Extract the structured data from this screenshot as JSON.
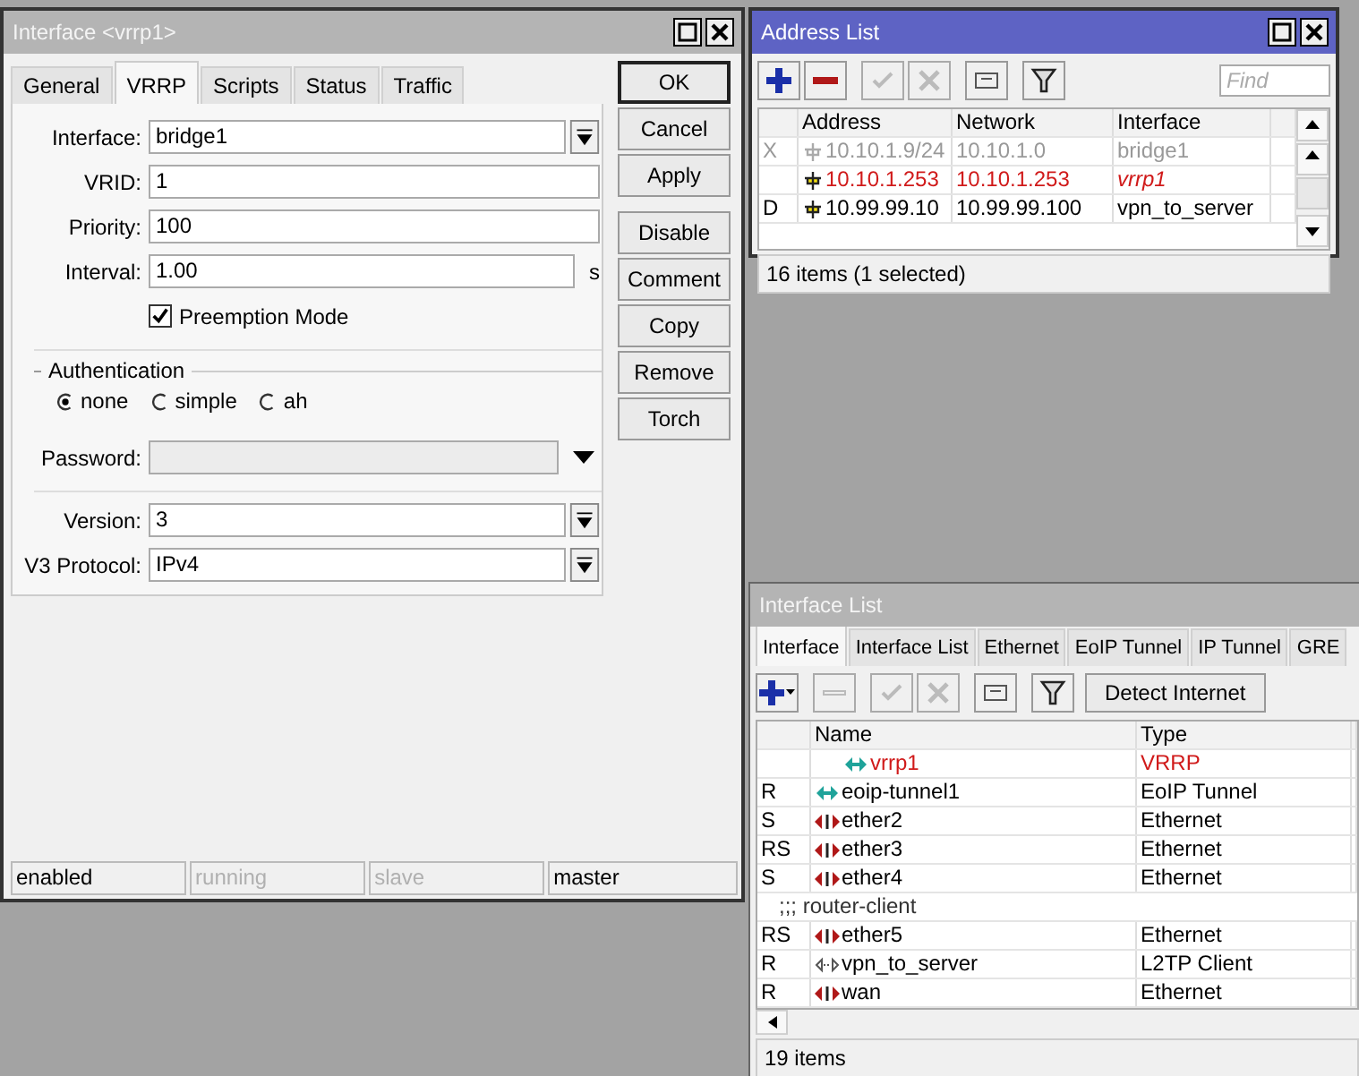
{
  "interface_window": {
    "title": "Interface <vrrp1>",
    "tabs": [
      {
        "label": "General",
        "selected": false
      },
      {
        "label": "VRRP",
        "selected": true
      },
      {
        "label": "Scripts",
        "selected": false
      },
      {
        "label": "Status",
        "selected": false
      },
      {
        "label": "Traffic",
        "selected": false
      }
    ],
    "fields": [
      {
        "label": "Interface:",
        "value": "bridge1",
        "kind": "dropdown"
      },
      {
        "label": "VRID:",
        "value": "1",
        "kind": "text"
      },
      {
        "label": "Priority:",
        "value": "100",
        "kind": "text"
      },
      {
        "label": "Interval:",
        "value": "1.00",
        "kind": "unit",
        "unit": "s"
      }
    ],
    "preemption": {
      "label": "Preemption Mode",
      "checked": true
    },
    "authentication": {
      "title": "Authentication",
      "options": [
        {
          "label": "none",
          "selected": true
        },
        {
          "label": "simple",
          "selected": false
        },
        {
          "label": "ah",
          "selected": false
        }
      ]
    },
    "password": {
      "label": "Password:",
      "disabled": true
    },
    "fields2": [
      {
        "label": "Version:",
        "value": "3",
        "kind": "dropdown"
      },
      {
        "label": "V3 Protocol:",
        "value": "IPv4",
        "kind": "dropdown"
      }
    ],
    "buttons": [
      {
        "label": "OK",
        "default": true
      },
      {
        "label": "Cancel",
        "default": false
      },
      {
        "label": "Apply",
        "default": false
      }
    ],
    "action_buttons": [
      {
        "label": "Disable"
      },
      {
        "label": "Comment"
      },
      {
        "label": "Copy"
      },
      {
        "label": "Remove"
      },
      {
        "label": "Torch"
      }
    ],
    "status_bar": [
      {
        "text": "enabled",
        "disabled": false
      },
      {
        "text": "running",
        "disabled": true
      },
      {
        "text": "slave",
        "disabled": true
      },
      {
        "text": "master",
        "disabled": false
      }
    ]
  },
  "address_list": {
    "title": "Address List",
    "find_placeholder": "Find",
    "columns": [
      "Address",
      "Network",
      "Interface"
    ],
    "rows": [
      {
        "flag": "X",
        "address": "10.10.1.9/24",
        "network": "10.10.1.0",
        "interface": "bridge1",
        "kind": "disabled"
      },
      {
        "address": "10.10.1.253",
        "network": "10.10.1.253",
        "interface": "vrrp1",
        "kind": "invalid"
      },
      {
        "flag": "D",
        "address": "10.99.99.10",
        "network": "10.99.99.100",
        "interface": "vpn_to_server",
        "kind": "normal"
      }
    ],
    "status": "16 items (1 selected)"
  },
  "interface_list": {
    "title": "Interface List",
    "tabs": [
      {
        "label": "Interface",
        "selected": true
      },
      {
        "label": "Interface List",
        "selected": false
      },
      {
        "label": "Ethernet",
        "selected": false
      },
      {
        "label": "EoIP Tunnel",
        "selected": false
      },
      {
        "label": "IP Tunnel",
        "selected": false
      },
      {
        "label": "GRE",
        "selected": false
      }
    ],
    "detect_button": "Detect Internet",
    "columns": [
      "Name",
      "Type"
    ],
    "rows": [
      {
        "name": "vrrp1",
        "type": "VRRP",
        "kind": "vrrp",
        "inactive": true,
        "nested": true
      },
      {
        "flag": "R",
        "name": "eoip-tunnel1",
        "type": "EoIP Tunnel",
        "kind": "eoip",
        "inactive": false,
        "nested": false
      },
      {
        "flag": "S",
        "name": "ether2",
        "type": "Ethernet",
        "kind": "ethernet",
        "inactive": false,
        "nested": false
      },
      {
        "flag": "RS",
        "name": "ether3",
        "type": "Ethernet",
        "kind": "ethernet",
        "inactive": false,
        "nested": false
      },
      {
        "flag": "S",
        "name": "ether4",
        "type": "Ethernet",
        "kind": "ethernet",
        "inactive": false,
        "nested": false
      },
      {
        "comment": ";;; router-client",
        "kind": "comment"
      },
      {
        "flag": "RS",
        "name": "ether5",
        "type": "Ethernet",
        "kind": "ethernet",
        "inactive": false,
        "nested": false
      },
      {
        "flag": "R",
        "name": "vpn_to_server",
        "type": "L2TP Client",
        "kind": "l2tp",
        "inactive": false,
        "nested": false
      },
      {
        "flag": "R",
        "name": "wan",
        "type": "Ethernet",
        "kind": "ethernet",
        "inactive": false,
        "nested": false
      }
    ],
    "status": "19 items"
  }
}
